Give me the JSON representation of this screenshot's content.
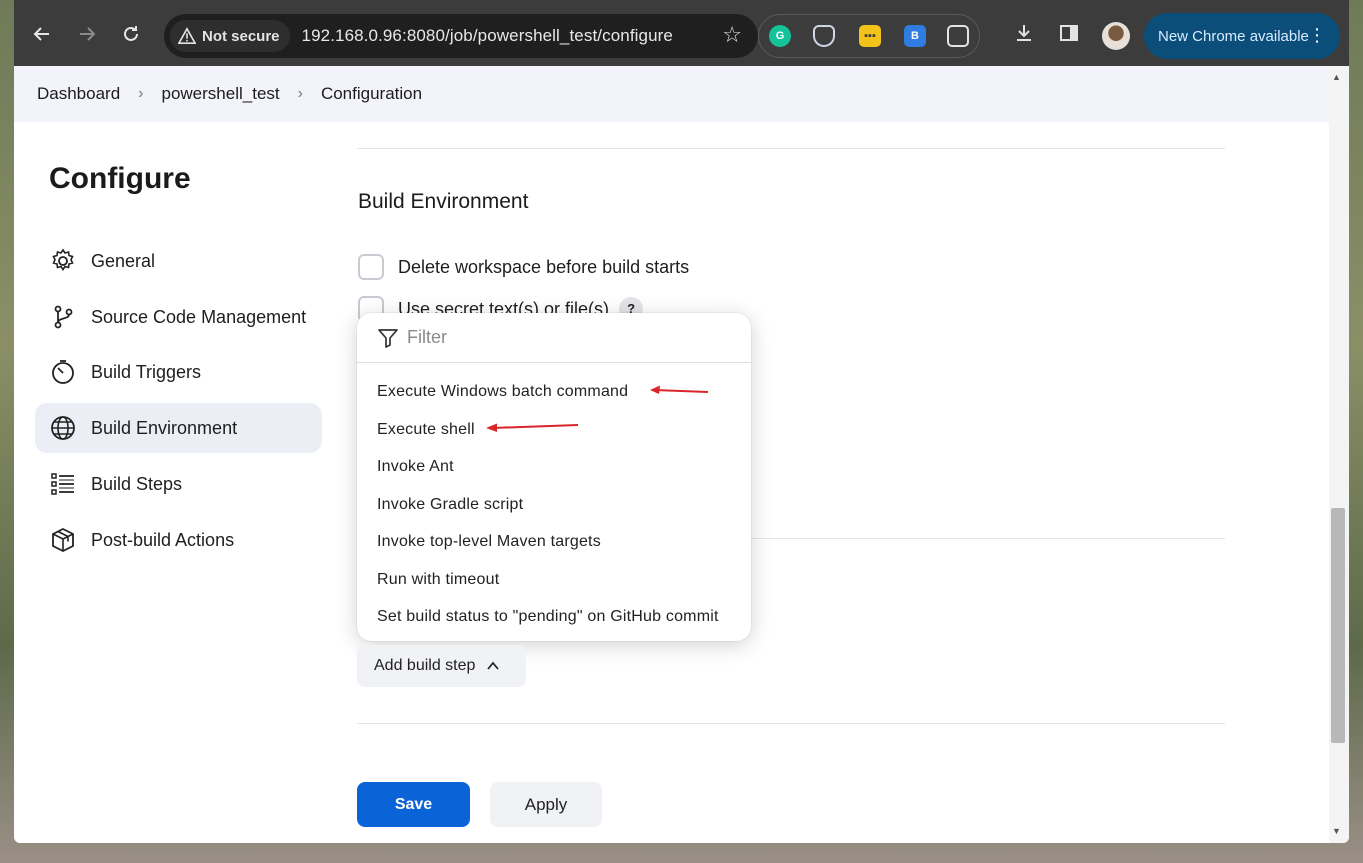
{
  "browser": {
    "security_label": "Not secure",
    "url": "192.168.0.96:8080/job/powershell_test/configure",
    "update_label": "New Chrome available"
  },
  "breadcrumb": [
    "Dashboard",
    "powershell_test",
    "Configuration"
  ],
  "sidebar": {
    "title": "Configure",
    "items": [
      {
        "label": "General",
        "icon": "gear-icon"
      },
      {
        "label": "Source Code Management",
        "icon": "branch-icon"
      },
      {
        "label": "Build Triggers",
        "icon": "timer-icon"
      },
      {
        "label": "Build Environment",
        "icon": "globe-icon",
        "active": true
      },
      {
        "label": "Build Steps",
        "icon": "list-icon"
      },
      {
        "label": "Post-build Actions",
        "icon": "package-icon"
      }
    ]
  },
  "main": {
    "section_title": "Build Environment",
    "checkboxes": [
      {
        "label": "Delete workspace before build starts",
        "checked": false
      },
      {
        "label": "Use secret text(s) or file(s)",
        "checked": false,
        "help": "?"
      }
    ]
  },
  "dropdown": {
    "filter_placeholder": "Filter",
    "items": [
      "Execute Windows batch command",
      "Execute shell",
      "Invoke Ant",
      "Invoke Gradle script",
      "Invoke top-level Maven targets",
      "Run with timeout",
      "Set build status to \"pending\" on GitHub commit"
    ]
  },
  "actions": {
    "add_build_step": "Add build step",
    "save": "Save",
    "apply": "Apply"
  },
  "colors": {
    "primary": "#0b63d8",
    "annotation": "#d9262a",
    "active_nav": "#eceef5"
  }
}
